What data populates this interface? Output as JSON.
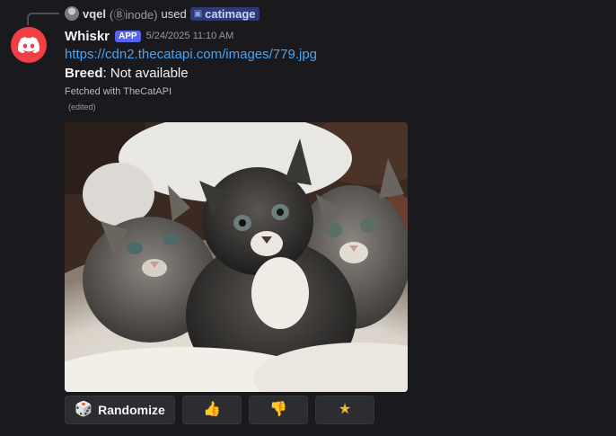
{
  "reply": {
    "username": "vqel",
    "tag": "(Ⓑinode)",
    "used_text": "used",
    "command": "catimage"
  },
  "message": {
    "author": "Whiskr",
    "badge": "APP",
    "timestamp": "5/24/2025 11:10 AM",
    "link": "https://cdn2.thecatapi.com/images/779.jpg",
    "breed_label": "Breed",
    "breed_value": ": Not available",
    "footer": "Fetched with TheCatAPI",
    "edited": "(edited)"
  },
  "buttons": {
    "randomize_label": "Randomize",
    "randomize_icon": "dice-icon",
    "like_icon": "thumbs-up-icon",
    "dislike_icon": "thumbs-down-icon",
    "favorite_icon": "star-icon"
  },
  "colors": {
    "avatar_red": "#f23f43",
    "app_badge": "#5865f2",
    "link": "#4aa3f0"
  }
}
